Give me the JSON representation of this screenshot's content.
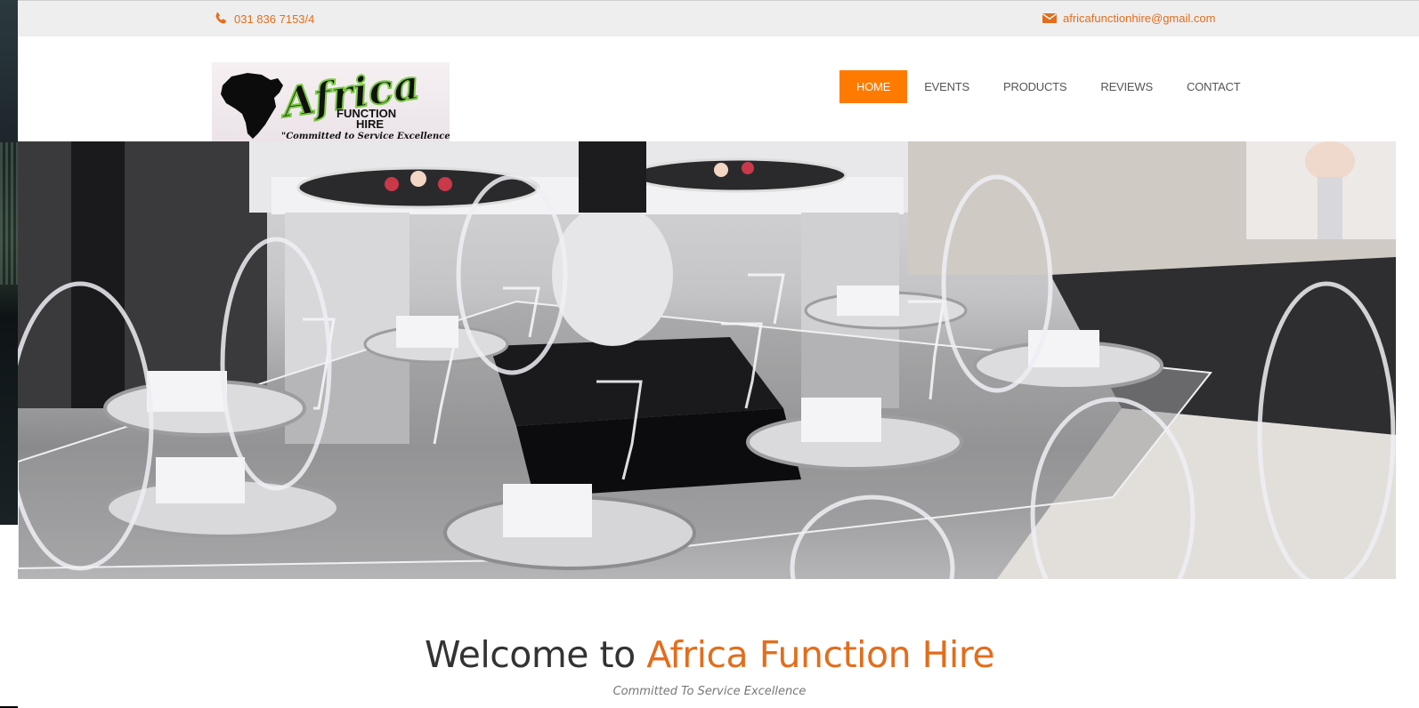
{
  "topbar": {
    "phone_icon": "phone-icon",
    "phone": "031 836 7153/4",
    "email_icon": "envelope-icon",
    "email": "africafunctionhire@gmail.com"
  },
  "logo": {
    "brand": "Africa",
    "line1": "FUNCTION",
    "line2": "HIRE",
    "slogan": "\"Committed to Service Excellence\""
  },
  "nav": {
    "items": [
      {
        "label": "HOME",
        "active": true
      },
      {
        "label": "EVENTS"
      },
      {
        "label": "PRODUCTS"
      },
      {
        "label": "REVIEWS"
      },
      {
        "label": "CONTACT"
      }
    ]
  },
  "hero": {
    "image": "banquet-table-setting-photo"
  },
  "welcome": {
    "prefix": "Welcome to",
    "brand": "Africa Function Hire",
    "tagline": "Committed To Service Excellence"
  },
  "colors": {
    "accent": "#ff7a00",
    "brand_text": "#e36d1c",
    "topbar_bg": "#eeeeee"
  }
}
